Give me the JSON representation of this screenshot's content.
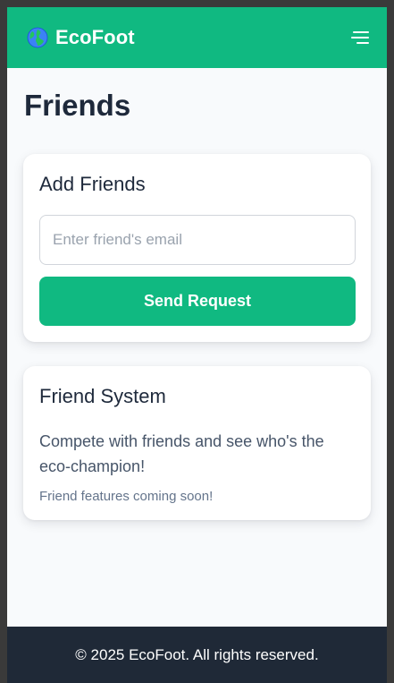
{
  "header": {
    "brand": "EcoFoot",
    "logo_icon": "globe-icon",
    "menu_icon": "hamburger-menu-icon",
    "color": "#10b981"
  },
  "page": {
    "title": "Friends"
  },
  "add_friends": {
    "title": "Add Friends",
    "email_placeholder": "Enter friend's email",
    "email_value": "",
    "send_label": "Send Request"
  },
  "friend_system": {
    "title": "Friend System",
    "description": "Compete with friends and see who's the eco-champion!",
    "note": "Friend features coming soon!"
  },
  "footer": {
    "text": "© 2025 EcoFoot. All rights reserved.",
    "color": "#1f2937"
  }
}
